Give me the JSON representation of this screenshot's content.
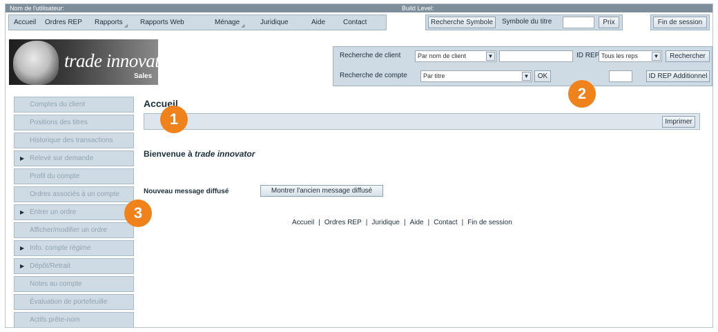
{
  "status": {
    "user_label": "Nom de l'utilisateur:",
    "build_label": "Build Level:"
  },
  "nav": {
    "items": [
      "Accueil",
      "Ordres REP",
      "Rapports",
      "Rapports Web",
      "Ménage",
      "Juridique",
      "Aide",
      "Contact"
    ]
  },
  "symbol_search": {
    "button": "Recherche Symbole",
    "label": "Symbole du titre",
    "value": "",
    "price_button": "Prix"
  },
  "logout_label": "Fin de session",
  "logo": {
    "brand": "trade innovator",
    "sub": "Sales"
  },
  "search": {
    "client_label": "Recherche de client",
    "client_select": "Par nom de client",
    "client_value": "",
    "rep_id_label": "ID REP",
    "rep_select": "Tous les reps",
    "search_button": "Rechercher",
    "account_label": "Recherche de compte",
    "account_select": "Par titre",
    "ok_button": "OK",
    "additional_rep_value": "",
    "additional_rep_button": "ID REP Additionnel"
  },
  "sidebar": {
    "items": [
      {
        "label": "Comptes du client",
        "expandable": false
      },
      {
        "label": "Positions des titres",
        "expandable": false
      },
      {
        "label": "Historique des transactions",
        "expandable": false
      },
      {
        "label": "Relevé sur demande",
        "expandable": true
      },
      {
        "label": "Profil du compte",
        "expandable": false
      },
      {
        "label": "Ordres associés à un compte",
        "expandable": false
      },
      {
        "label": "Entrer un ordre",
        "expandable": true
      },
      {
        "label": "Afficher/modifier un ordre",
        "expandable": false
      },
      {
        "label": "Info. compte régime",
        "expandable": true
      },
      {
        "label": "Dépôt/Retrait",
        "expandable": true
      },
      {
        "label": "Notes au compte",
        "expandable": false
      },
      {
        "label": "Évaluation de portefeuille",
        "expandable": false
      },
      {
        "label": "Actifs prête-nom",
        "expandable": false
      }
    ]
  },
  "main": {
    "title": "Accueil",
    "print_button": "Imprimer",
    "welcome_prefix": "Bienvenue à ",
    "welcome_brand": "trade innovator",
    "broadcast_label": "Nouveau message diffusé",
    "broadcast_button": "Montrer l'ancien message diffusé"
  },
  "footer": {
    "links": [
      "Accueil",
      "Ordres REP",
      "Juridique",
      "Aide",
      "Contact",
      "Fin de session"
    ]
  },
  "markers": [
    "1",
    "2",
    "3"
  ],
  "colors": {
    "marker": "#f0821c",
    "panel": "#cfdbe4",
    "status_bar": "#7d8e9a"
  }
}
